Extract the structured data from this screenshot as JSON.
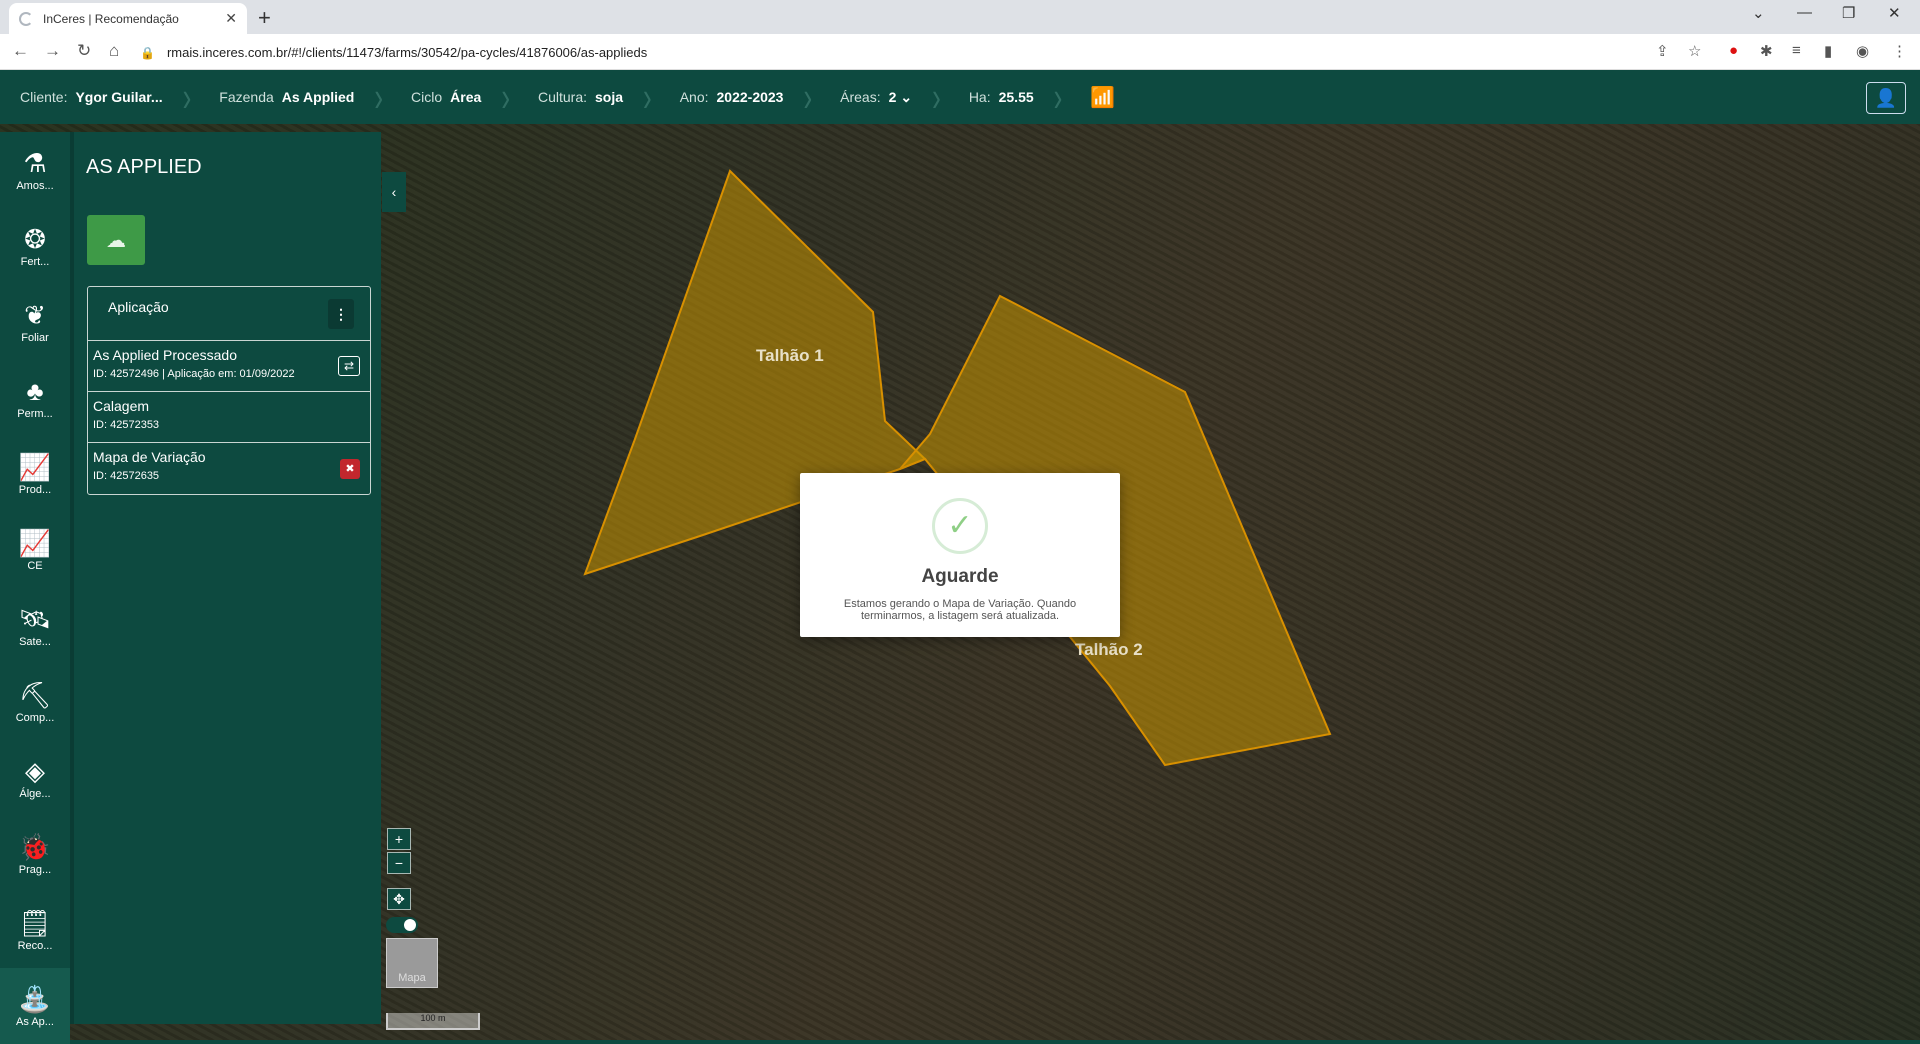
{
  "browser": {
    "tab_title": "InCeres | Recomendação",
    "tab_close": "✕",
    "new_tab": "+",
    "url": "rmais.inceres.com.br/#!/clients/11473/farms/30542/pa-cycles/41876006/as-applieds"
  },
  "topbar": {
    "cliente_label": "Cliente:",
    "cliente_value": "Ygor Guilar...",
    "fazenda_label": "Fazenda",
    "fazenda_value": "As Applied",
    "ciclo_label": "Ciclo",
    "ciclo_value": "Área",
    "cultura_label": "Cultura:",
    "cultura_value": "soja",
    "ano_label": "Ano:",
    "ano_value": "2022-2023",
    "areas_label": "Áreas:",
    "areas_value": "2",
    "ha_label": "Ha:",
    "ha_value": "25.55"
  },
  "rail": {
    "items": [
      {
        "label": "Amos...",
        "icon": "soil-sample-icon"
      },
      {
        "label": "Fert...",
        "icon": "fertilizer-icon"
      },
      {
        "label": "Foliar",
        "icon": "leaf-icon"
      },
      {
        "label": "Perm...",
        "icon": "field-icon"
      },
      {
        "label": "Prod...",
        "icon": "productivity-chart-icon"
      },
      {
        "label": "CE",
        "icon": "ce-chart-icon"
      },
      {
        "label": "Sate...",
        "icon": "satellite-icon"
      },
      {
        "label": "Comp...",
        "icon": "compaction-icon"
      },
      {
        "label": "Álge...",
        "icon": "layers-icon"
      },
      {
        "label": "Prag...",
        "icon": "bug-icon"
      },
      {
        "label": "Reco...",
        "icon": "recommendation-icon"
      },
      {
        "label": "As Ap...",
        "icon": "sprayer-icon"
      }
    ]
  },
  "panel": {
    "title": "AS APPLIED",
    "list_header": "Aplicação",
    "items": [
      {
        "name": "As Applied Processado",
        "sub": "ID: 42572496 | Aplicação em: 01/09/2022"
      },
      {
        "name": "Calagem",
        "sub": "ID: 42572353"
      },
      {
        "name": "Mapa de Variação",
        "sub": "ID: 42572635"
      }
    ]
  },
  "map": {
    "field1": "Talhão 1",
    "field2": "Talhão 2",
    "zoom_in": "+",
    "zoom_out": "−",
    "basemap_label": "Mapa",
    "scale": "100 m"
  },
  "modal": {
    "title": "Aguarde",
    "message": "Estamos gerando o Mapa de Variação. Quando terminarmos, a listagem será atualizada."
  }
}
